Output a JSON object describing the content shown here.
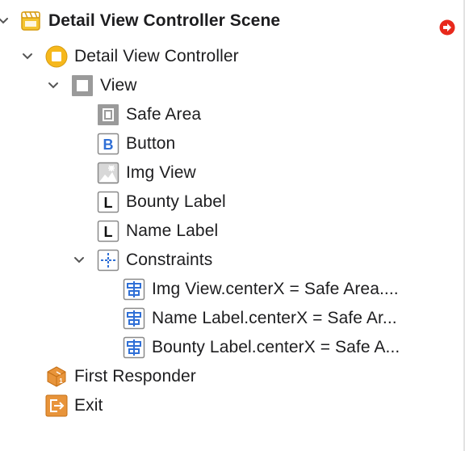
{
  "scene": {
    "title": "Detail View Controller Scene",
    "items": {
      "detail_vc": "Detail View Controller",
      "view": "View",
      "safe_area": "Safe Area",
      "button": "Button",
      "img_view": "Img View",
      "bounty_label": "Bounty Label",
      "name_label": "Name Label",
      "constraints": "Constraints",
      "constraint_1": "Img View.centerX = Safe Area....",
      "constraint_2": "Name Label.centerX = Safe Ar...",
      "constraint_3": "Bounty Label.centerX = Safe A...",
      "first_responder": "First Responder",
      "exit": "Exit"
    }
  },
  "icons": {
    "scene": "storyboard-scene-icon",
    "view_controller": "view-controller-icon",
    "view": "view-icon",
    "safe_area": "safe-area-icon",
    "button": "button-icon",
    "image_view": "image-view-icon",
    "label": "label-icon",
    "constraints": "constraints-icon",
    "constraint": "constraint-icon",
    "first_responder": "first-responder-icon",
    "exit": "exit-icon",
    "error": "error-arrow-icon"
  },
  "colors": {
    "scene_yellow": "#f4c430",
    "vc_yellow": "#f6b81c",
    "constraint_blue": "#2f6fd6",
    "exit_orange": "#e8943a",
    "error_red": "#e8291c"
  }
}
